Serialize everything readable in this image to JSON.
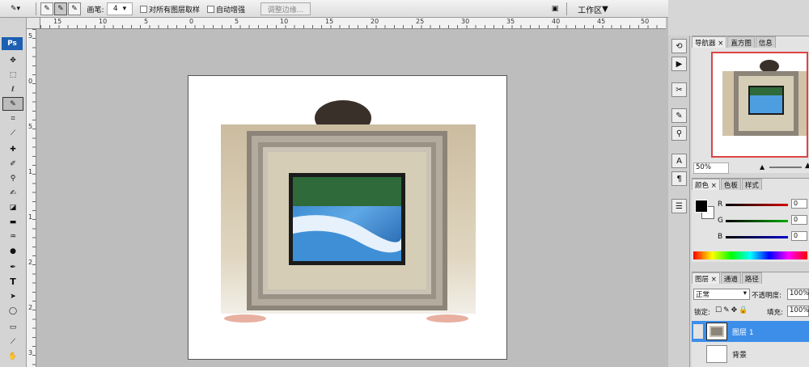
{
  "options_bar": {
    "brush_label": "画笔:",
    "brush_size": "4",
    "sample_all_label": "对所有图层取样",
    "auto_enhance_label": "自动增强",
    "refine_edge_label": "调整边缘...",
    "workspace_label": "工作区"
  },
  "app": {
    "logo": "Ps"
  },
  "ruler": {
    "h_ticks": [
      "15",
      "10",
      "5",
      "0",
      "5",
      "10",
      "15",
      "20",
      "25",
      "30",
      "35",
      "40",
      "45",
      "50"
    ],
    "v_ticks": [
      "5",
      "0",
      "5",
      "1",
      "1",
      "2",
      "2",
      "3"
    ]
  },
  "navigator": {
    "tabs": [
      "导航器",
      "直方图",
      "信息"
    ],
    "zoom": "50%"
  },
  "color": {
    "tabs": [
      "颜色",
      "色板",
      "样式"
    ],
    "channels": [
      {
        "label": "R",
        "value": "0"
      },
      {
        "label": "G",
        "value": "0"
      },
      {
        "label": "B",
        "value": "0"
      }
    ],
    "colors": {
      "red": "#d40000",
      "green": "#00aa00",
      "blue": "#0000cc"
    }
  },
  "layers": {
    "tabs": [
      "图层",
      "通道",
      "路径"
    ],
    "blend_mode": "正常",
    "opacity_label": "不透明度:",
    "opacity_value": "100%",
    "lock_label": "锁定:",
    "fill_label": "填充:",
    "fill_value": "100%",
    "layer_name": "图层 1",
    "row2_label": "背景"
  },
  "icons": [
    "move-icon",
    "marquee-icon",
    "lasso-icon",
    "quick-select-icon",
    "crop-icon",
    "eyedropper-icon",
    "healing-icon",
    "brush-icon",
    "stamp-icon",
    "history-brush-icon",
    "eraser-icon",
    "gradient-icon",
    "blur-icon",
    "dodge-icon",
    "pen-icon",
    "type-icon",
    "path-select-icon",
    "shape-icon",
    "notes-icon",
    "eyedropper2-icon",
    "hand-icon"
  ]
}
